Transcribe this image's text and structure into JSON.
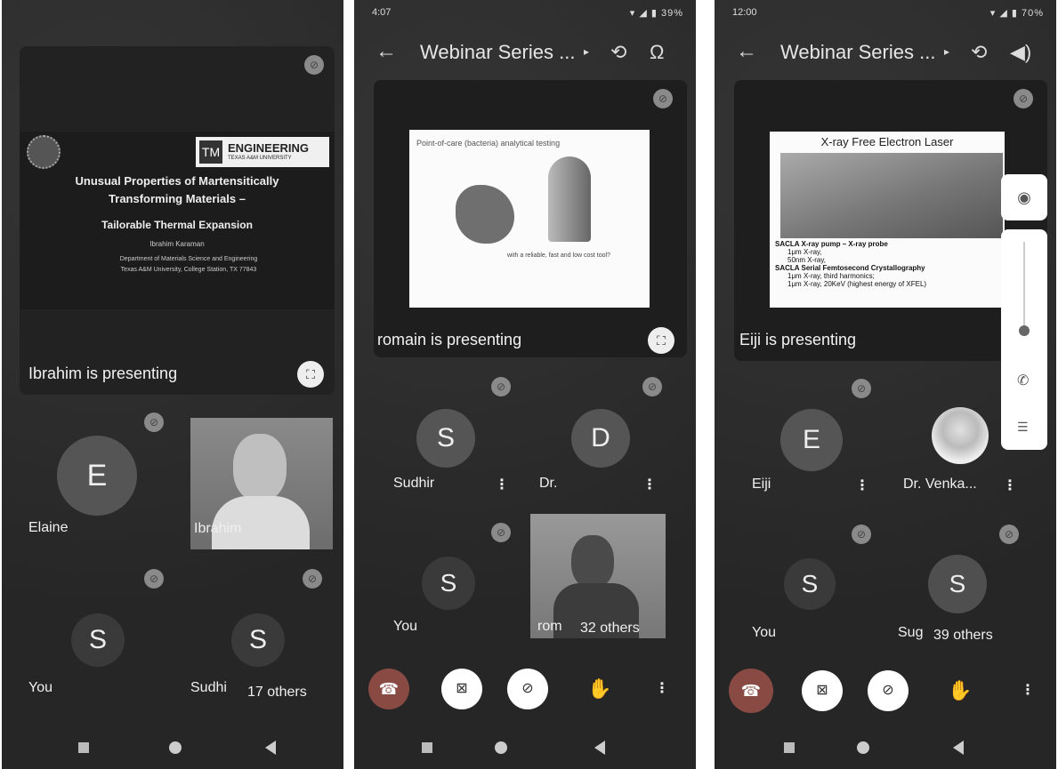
{
  "phone1": {
    "slide": {
      "brand": "ENGINEERING",
      "brand_sub": "TEXAS A&M UNIVERSITY",
      "title_line1": "Unusual Properties of Martensitically",
      "title_line2": "Transforming Materials –",
      "subtitle": "Tailorable Thermal Expansion",
      "author": "Ibrahim Karaman",
      "affil1": "Department of Materials Science and Engineering",
      "affil2": "Texas A&M University, College Station, TX 77843"
    },
    "presenting": "Ibrahim is presenting",
    "tiles": [
      {
        "name": "Elaine",
        "initial": "E"
      },
      {
        "name": "Ibrahim"
      },
      {
        "name": "You",
        "initial": "S"
      },
      {
        "name": "Sudhi",
        "initial": "S",
        "others": "17 others"
      }
    ]
  },
  "phone2": {
    "time": "4:07",
    "battery": "39%",
    "title": "Webinar Series ...",
    "slide_title": "Point-of-care (bacteria) analytical testing",
    "slide_caption": "with a reliable, fast and low cost tool?",
    "presenting": "romain is presenting",
    "tiles": [
      {
        "name": "Sudhir",
        "initial": "S"
      },
      {
        "name": "Dr.",
        "initial": "D"
      },
      {
        "name": "You",
        "initial": "S"
      },
      {
        "name": "rom",
        "others": "32 others"
      }
    ]
  },
  "phone3": {
    "time": "12:00",
    "battery": "70%",
    "title": "Webinar Series ...",
    "slide_title": "X-ray Free Electron Laser",
    "bullets": [
      "SACLA X-ray pump – X-ray probe",
      "1μm X-ray,",
      "50nm X-ray,",
      "SACLA Serial Femtosecond Crystallography",
      "1μm X-ray, third harmonics;",
      "1μm X-ray, 20KeV (highest energy of XFEL)"
    ],
    "presenting": "Eiji is presenting",
    "tiles": [
      {
        "name": "Eiji",
        "initial": "E"
      },
      {
        "name": "Dr. Venka..."
      },
      {
        "name": "You",
        "initial": "S"
      },
      {
        "name": "Sug",
        "initial": "S",
        "others": "39 others"
      }
    ]
  },
  "colors": {
    "end_call": "#c0392b",
    "tile_bg": "#2b2b2b",
    "control_bg": "#ffffff"
  }
}
